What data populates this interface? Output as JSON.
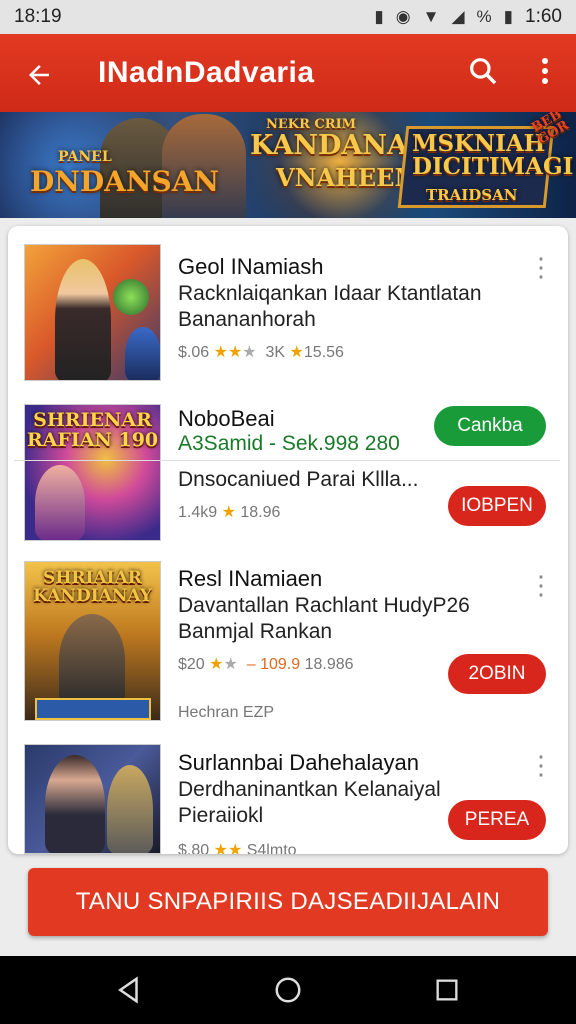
{
  "status": {
    "time": "18:19",
    "battery_text": "1:60",
    "percent_glyph": "%"
  },
  "app_bar": {
    "title": "INadnDadvaria",
    "back_icon": "arrow-back-icon",
    "search_icon": "search-icon",
    "more_icon": "more-vert-icon"
  },
  "banner": {
    "text_left": "DNDANSAN",
    "text_left_small": "PANEL",
    "text_center": "KANDANAAR",
    "text_center_sub": "VNAHEEM",
    "text_center_top": "NEKR CRIM",
    "text_right": "MSKNIAH DICITIMAGI",
    "text_right_sub": "TRAIDSAN",
    "text_corner": "BEB GOR"
  },
  "items": [
    {
      "name": "Geol INamiash",
      "line1": "Racknlaiqankan Idaar Ktantlatan",
      "line2": "Banananhorah",
      "meta_a": "$.06",
      "meta_b": "3K",
      "meta_c": "15.56",
      "action": "",
      "art": ""
    },
    {
      "name": "NoboBeai",
      "line1": "A3Samid - Sek.998 280",
      "line2": "Dnsocaniued Parai Kllla...",
      "meta_a": "1.4k9",
      "meta_b": "18.96",
      "action": "Cankba",
      "action2": "IOBPEN",
      "art": "SHRIENAR RAFIAN 190"
    },
    {
      "name": "Resl INamiaen",
      "line1": "Davantallan Rachlant HudyP26",
      "line2": "Banmjal Rankan",
      "meta_a": "$20",
      "meta_b": "– 109.9",
      "meta_c": "18.986",
      "action": "2OBIN",
      "extra": "Hechran EZP",
      "art": "SHRIAIAR KANDIANAY"
    },
    {
      "name": "Surlannbai Dahehalayan",
      "line1": "Derdhaninantkan Kelanaiyal",
      "line2": "Pieraiiokl",
      "meta_a": "$.80",
      "meta_b": "S4lmto",
      "action": "PEREA",
      "art": ""
    }
  ],
  "bottom_button": "TANU SNPAPIRIIS DAJSEADIIJALAIN",
  "nav": {
    "back": "nav-back-icon",
    "home": "nav-home-icon",
    "recents": "nav-recents-icon"
  },
  "colors": {
    "accent": "#e23a22",
    "green": "#1a9b3a",
    "star": "#f0a300"
  }
}
